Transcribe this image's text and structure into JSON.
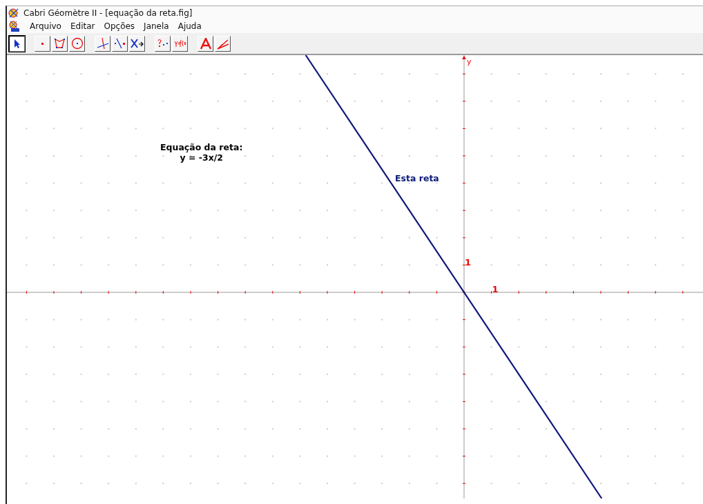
{
  "window": {
    "title": "Cabri Géomètre II - [equação da reta.fig]"
  },
  "menu": [
    "Arquivo",
    "Editar",
    "Opções",
    "Janela",
    "Ajuda"
  ],
  "toolbar": [
    [
      {
        "kind": "pointer",
        "selected": true
      }
    ],
    [
      {
        "kind": "point",
        "selected": false
      },
      {
        "kind": "polygon",
        "selected": false
      },
      {
        "kind": "circle",
        "selected": false
      }
    ],
    [
      {
        "kind": "perpendicular",
        "selected": false
      },
      {
        "kind": "pointline",
        "selected": false
      },
      {
        "kind": "transform",
        "selected": false
      }
    ],
    [
      {
        "kind": "check",
        "selected": false
      },
      {
        "kind": "calculate",
        "selected": false
      }
    ],
    [
      {
        "kind": "text",
        "selected": false
      },
      {
        "kind": "mark",
        "selected": false
      }
    ]
  ],
  "canvas": {
    "axes": {
      "x_unit_label": "1",
      "y_unit_label": "1",
      "y_label": "y"
    },
    "texts": [
      {
        "kind": "equation",
        "lines": [
          "Equação da reta:",
          "y = -3x/2"
        ]
      },
      {
        "kind": "line_label",
        "lines": [
          "Esta reta"
        ]
      }
    ]
  }
}
